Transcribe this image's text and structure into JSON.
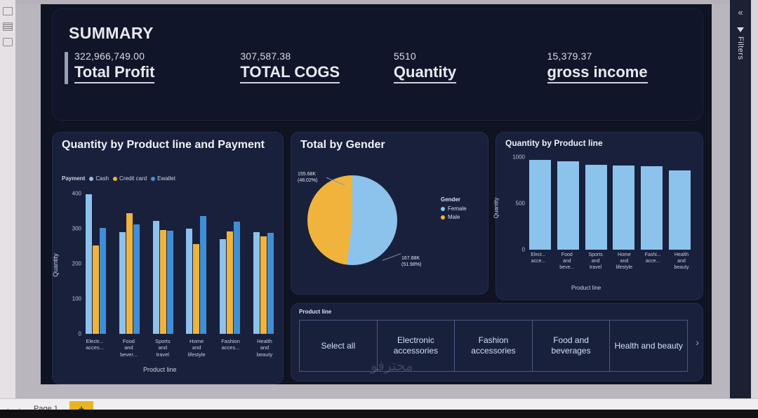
{
  "app": {
    "filters_label": "Filters",
    "collapse_icon": "chevron-double-left-icon",
    "funnel_icon": "funnel-icon"
  },
  "statusbar": {
    "nav_prev": "‹",
    "nav_next": "›",
    "page_tab": "Page 1",
    "add_page": "+"
  },
  "watermark": "محترفو",
  "summary": {
    "title": "SUMMARY",
    "kpis": [
      {
        "value": "322,966,749.00",
        "label": "Total Profit"
      },
      {
        "value": "307,587.38",
        "label": "TOTAL COGS"
      },
      {
        "value": "5510",
        "label": "Quantity"
      },
      {
        "value": "15,379.37",
        "label": "gross income"
      }
    ]
  },
  "colors": {
    "cash": "#8cc3ec",
    "credit_card": "#f0b43c",
    "ewallet": "#3f8fd6",
    "female": "#8cc3ec",
    "male": "#f0b43c",
    "canvas": "#0f1322",
    "card": "#19203c",
    "accent_yellow": "#e9b422"
  },
  "visuals": {
    "bar_payment": {
      "title": "Quantity by Product line and Payment",
      "legend_title": "Payment",
      "footer_icons": [
        "filter-icon",
        "focus-mode-icon",
        "more-options-icon"
      ]
    },
    "pie_gender": {
      "title": "Total by Gender",
      "legend_title": "Gender",
      "label_male": "155.68K\n(48.02%)",
      "label_male_value": "155.68K",
      "label_male_pct": "(48.02%)",
      "label_female_value": "167.88K",
      "label_female_pct": "(51.98%)"
    },
    "bar_quantity": {
      "title": "Quantity by Product line",
      "footer_icons": [
        "filter-icon",
        "focus-mode-icon",
        "more-options-icon"
      ]
    },
    "slicer": {
      "title": "Product line",
      "tiles": [
        "Select all",
        "Electronic accessories",
        "Fashion accessories",
        "Food and beverages",
        "Health and beauty"
      ],
      "next_arrow": "›"
    }
  },
  "chart_data": [
    {
      "type": "bar",
      "title": "Quantity by Product line and Payment",
      "xlabel": "Product line",
      "ylabel": "Quantity",
      "ylim": [
        0,
        400
      ],
      "yticks": [
        0,
        100,
        200,
        300,
        400
      ],
      "grid": false,
      "legend_title": "Payment",
      "legend_position": "top-left",
      "categories": [
        "Electr... acces...",
        "Food and bever...",
        "Sports and travel",
        "Home and lifestyle",
        "Fashion acces...",
        "Health and beauty"
      ],
      "series": [
        {
          "name": "Cash",
          "color": "#8cc3ec",
          "values": [
            398,
            290,
            322,
            301,
            271,
            291
          ]
        },
        {
          "name": "Credit card",
          "color": "#f0b43c",
          "values": [
            253,
            345,
            297,
            257,
            292,
            278
          ]
        },
        {
          "name": "Ewallet",
          "color": "#3f8fd6",
          "values": [
            302,
            312,
            295,
            336,
            320,
            288
          ]
        }
      ]
    },
    {
      "type": "pie",
      "title": "Total by Gender",
      "legend_title": "Gender",
      "legend_position": "right",
      "labels": [
        "Female",
        "Male"
      ],
      "values": [
        167.88,
        155.68
      ],
      "value_labels": [
        "167.88K",
        "155.68K"
      ],
      "percents": [
        "51.98%",
        "48.02%"
      ],
      "colors": [
        "#8cc3ec",
        "#f0b43c"
      ],
      "unit": "K"
    },
    {
      "type": "bar",
      "title": "Quantity by Product line",
      "xlabel": "Product line",
      "ylabel": "Quantity",
      "ylim": [
        0,
        1000
      ],
      "yticks": [
        0,
        500,
        1000
      ],
      "grid": false,
      "categories": [
        "Elect... acce...",
        "Food and beve...",
        "Sports and travel",
        "Home and lifestyle",
        "Fashi... acce...",
        "Health and beauty"
      ],
      "values": [
        971,
        952,
        920,
        911,
        902,
        854
      ],
      "color": "#8cc3ec"
    }
  ]
}
